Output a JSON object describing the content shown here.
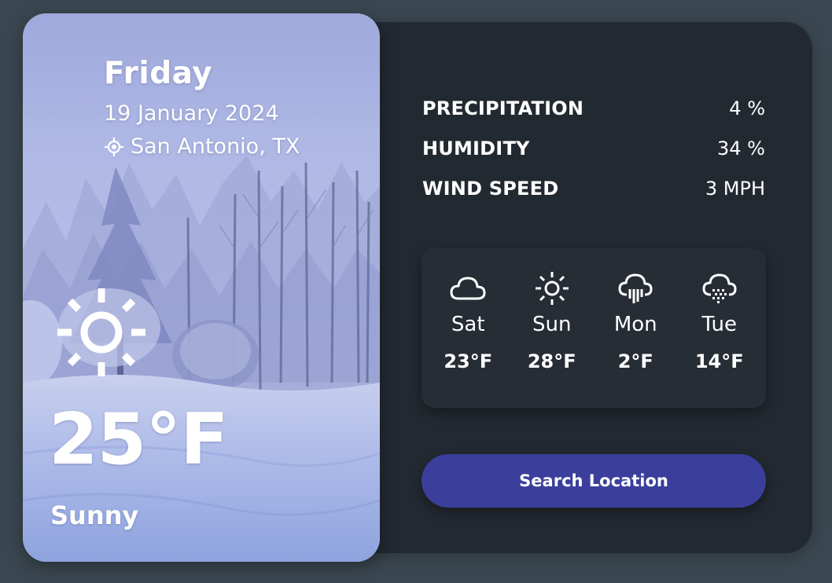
{
  "current": {
    "day": "Friday",
    "date": "19 January 2024",
    "location": "San Antonio, TX",
    "temperature": "25°F",
    "condition": "Sunny",
    "icon": "sun-icon"
  },
  "stats": [
    {
      "label": "PRECIPITATION",
      "value": "4 %"
    },
    {
      "label": "HUMIDITY",
      "value": "34 %"
    },
    {
      "label": "WIND SPEED",
      "value": "3 MPH"
    }
  ],
  "forecast": [
    {
      "day": "Sat",
      "temp": "23°F",
      "icon": "cloud-icon"
    },
    {
      "day": "Sun",
      "temp": "28°F",
      "icon": "sun-icon"
    },
    {
      "day": "Mon",
      "temp": "2°F",
      "icon": "rain-cloud-icon"
    },
    {
      "day": "Tue",
      "temp": "14°F",
      "icon": "snow-cloud-icon"
    }
  ],
  "search_button": {
    "label": "Search Location"
  },
  "colors": {
    "page_background": "#3b4750",
    "panel_background": "#232931",
    "forecast_background": "#272d35",
    "button_background": "#3a3f9c",
    "text": "#ffffff"
  }
}
